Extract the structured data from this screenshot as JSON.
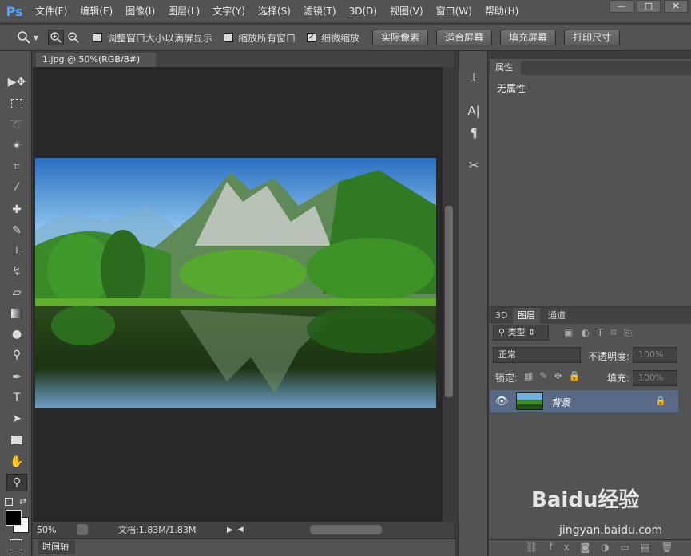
{
  "app": {
    "logo": "Ps"
  },
  "menu": [
    "文件(F)",
    "编辑(E)",
    "图像(I)",
    "图层(L)",
    "文字(Y)",
    "选择(S)",
    "滤镜(T)",
    "3D(D)",
    "视图(V)",
    "窗口(W)",
    "帮助(H)"
  ],
  "window_controls": {
    "minimize": "—",
    "maximize": "□",
    "close": "✕"
  },
  "options": {
    "resize_windows": "调整窗口大小以满屏显示",
    "zoom_all": "缩放所有窗口",
    "scrubby_zoom": "细微缩放",
    "scrubby_checked": true,
    "btn_actual": "实际像素",
    "btn_fit": "适合屏幕",
    "btn_fill": "填充屏幕",
    "btn_print": "打印尺寸"
  },
  "document": {
    "tab_title": "1.jpg @ 50%(RGB/8#)",
    "zoom": "50%",
    "doc_info": "文档:1.83M/1.83M"
  },
  "timeline": {
    "label": "时间轴"
  },
  "properties": {
    "title": "属性",
    "empty": "无属性"
  },
  "layers": {
    "tabs": [
      "3D",
      "图层",
      "通道"
    ],
    "filter_kind": "类型",
    "blend_mode": "正常",
    "opacity_label": "不透明度:",
    "opacity_value": "100%",
    "lock_label": "锁定:",
    "fill_label": "填充:",
    "fill_value": "100%",
    "layer_name": "背景"
  },
  "watermark": {
    "brand": "Baidu经验",
    "url": "jingyan.baidu.com"
  },
  "colors": {
    "accent": "#4fa3ff",
    "panel": "#535353",
    "canvas": "#282828",
    "selected_layer": "#596a86"
  }
}
